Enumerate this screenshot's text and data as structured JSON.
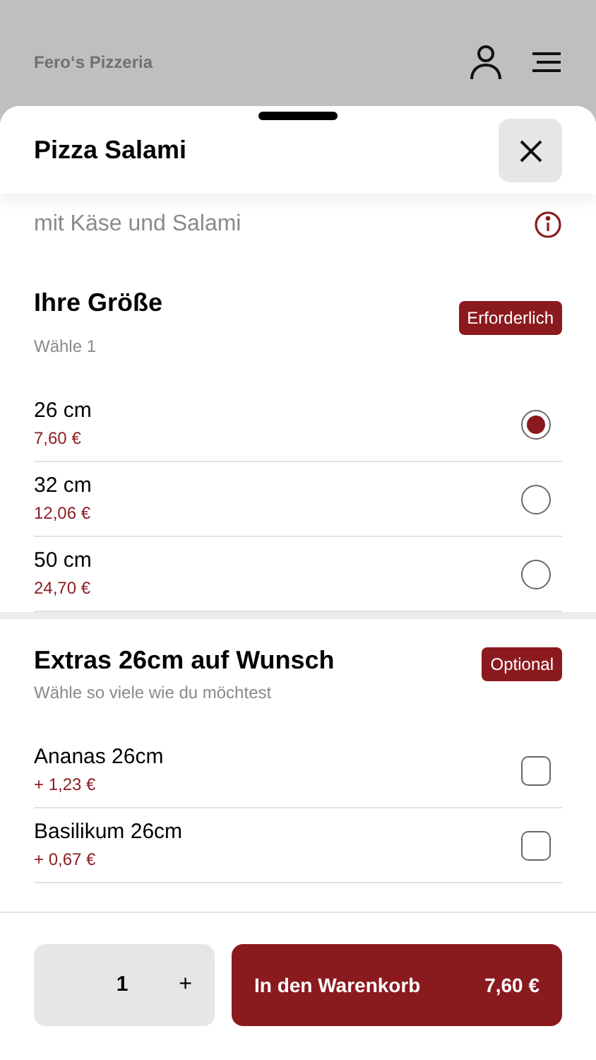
{
  "header": {
    "restaurant": "Fero‘s Pizzeria"
  },
  "sheet": {
    "title": "Pizza Salami",
    "description": "mit Käse und Salami"
  },
  "groups": [
    {
      "kind": "radio",
      "title": "Ihre Größe",
      "hint": "Wähle 1",
      "badge": "Erforderlich",
      "options": [
        {
          "name": "26 cm",
          "price": "7,60 €",
          "selected": true
        },
        {
          "name": "32 cm",
          "price": "12,06 €",
          "selected": false
        },
        {
          "name": "50 cm",
          "price": "24,70 €",
          "selected": false
        }
      ]
    },
    {
      "kind": "checkbox",
      "title": "Extras 26cm auf Wunsch",
      "hint": "Wähle so viele wie du möchtest",
      "badge": "Optional",
      "options": [
        {
          "name": "Ananas 26cm",
          "price": "+ 1,23 €",
          "checked": false
        },
        {
          "name": "Basilikum 26cm",
          "price": "+ 0,67 €",
          "checked": false
        }
      ]
    }
  ],
  "footer": {
    "quantity": "1",
    "plus": "+",
    "add_button": "In den Warenkorb",
    "total": "7,60 €"
  }
}
